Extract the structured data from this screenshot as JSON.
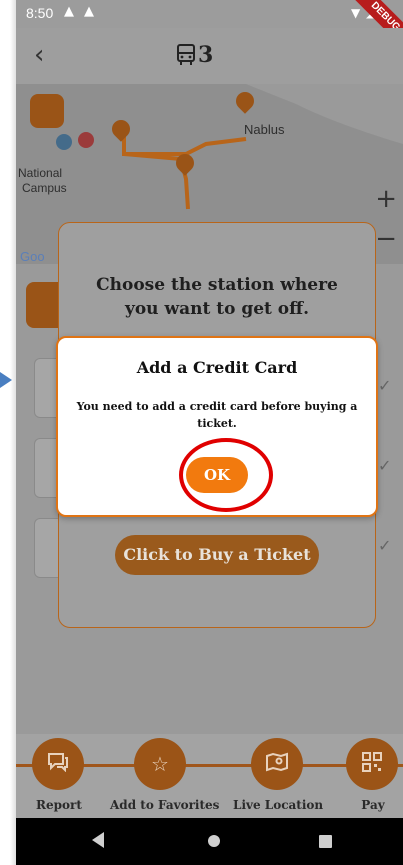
{
  "status_bar": {
    "time": "8:50",
    "debug_badge": "DEBUG"
  },
  "app_bar": {
    "back_icon": "back-arrow-icon",
    "bus_icon": "bus-icon",
    "bus_number": "3"
  },
  "map": {
    "labels": [
      "Nablus",
      "National",
      "Campus",
      "Goo"
    ],
    "zoom_in": "+",
    "zoom_out": "−"
  },
  "panel": {
    "title": "Choose the station where you want to get off.",
    "buy_button": "Click to Buy a Ticket"
  },
  "dialog": {
    "title": "Add a Credit Card",
    "message": "You need to add a credit card before buying a ticket.",
    "ok_label": "OK"
  },
  "actions": [
    {
      "label": "Report",
      "icon": "chat-icon"
    },
    {
      "label": "Add to Favorites",
      "icon": "star-icon"
    },
    {
      "label": "Live Location",
      "icon": "map-pin-icon"
    },
    {
      "label": "Pay",
      "icon": "qr-code-icon"
    }
  ],
  "colors": {
    "accent": "#f27a0e",
    "highlight_ring": "#e00000",
    "pointer": "#4a7fc1"
  }
}
